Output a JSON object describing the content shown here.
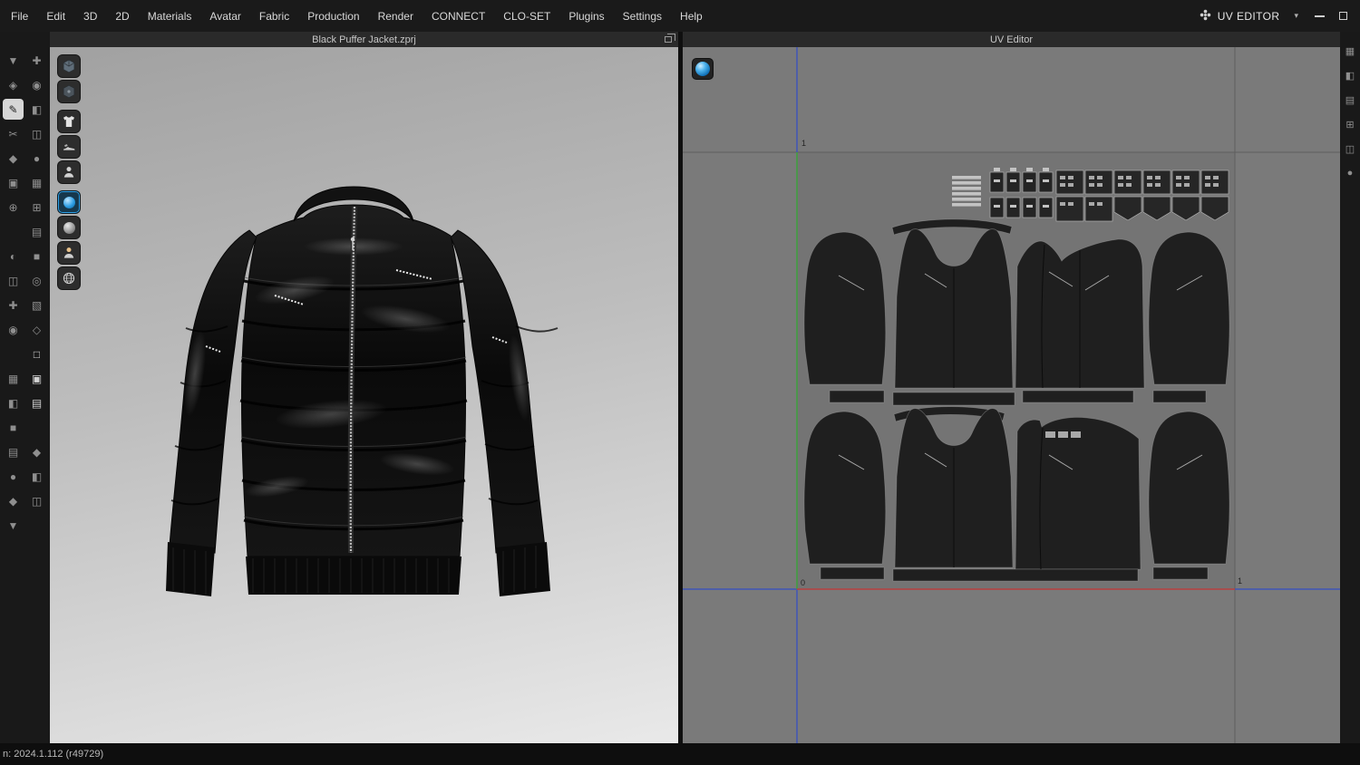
{
  "menubar": {
    "items": [
      "File",
      "Edit",
      "3D",
      "2D",
      "Materials",
      "Avatar",
      "Fabric",
      "Production",
      "Render",
      "CONNECT",
      "CLO-SET",
      "Plugins",
      "Settings",
      "Help"
    ],
    "uv_editor_label": "UV EDITOR"
  },
  "viewport3d": {
    "title": "Black Puffer Jacket.zprj"
  },
  "uv_editor": {
    "title": "UV Editor",
    "axis_top_label": "1",
    "axis_origin_label": "0",
    "axis_right_label": "1"
  },
  "statusbar": {
    "version_text": "n: 2024.1.112 (r49729)"
  },
  "colors": {
    "accent_blue": "#2e9fe6",
    "axis_green": "#3da03d",
    "axis_red": "#b84040",
    "axis_blue": "#4054b8",
    "uv_canvas_gray": "#7a7a7a",
    "pattern_piece_dark": "#1f1f1f"
  },
  "icons": {
    "uv_badge": "uv-editor-logo-icon",
    "window_controls": [
      "minimize-icon",
      "restore-icon"
    ],
    "viewport_toolbar": [
      "view-cube-high-icon",
      "view-cube-low-icon",
      "show-garment-icon",
      "show-shoes-icon",
      "show-avatar-icon",
      "paint-tool-icon",
      "eraser-tool-icon",
      "avatar-display-icon",
      "environment-icon"
    ],
    "uv_material": "material-sphere-icon"
  }
}
